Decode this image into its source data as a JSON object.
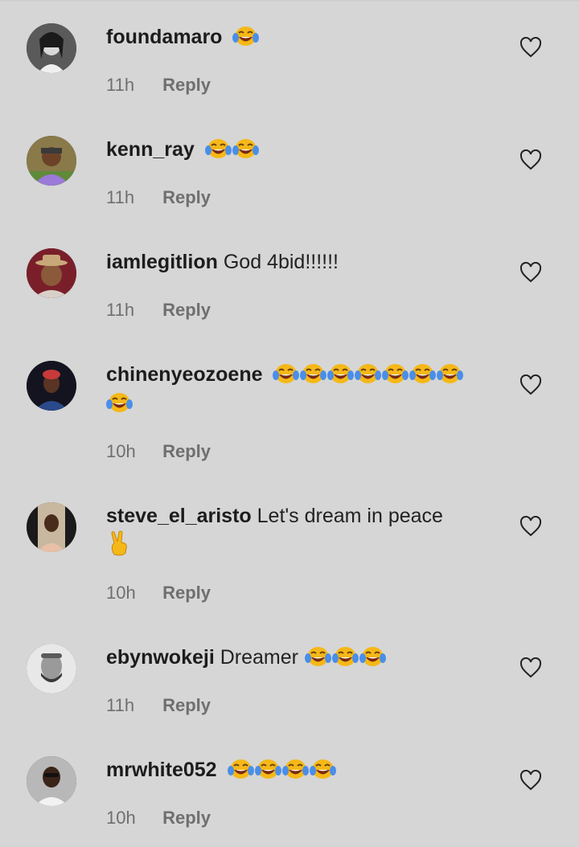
{
  "colors": {
    "background": "#d6d6d6",
    "username": "#1c1c1c",
    "meta": "#6f6f6f"
  },
  "comments": [
    {
      "username": "foundamaro",
      "text": "",
      "emojis": [
        "laughing-tears-emoji"
      ],
      "time": "11h",
      "reply_label": "Reply"
    },
    {
      "username": "kenn_ray",
      "text": "",
      "emojis": [
        "laughing-tears-emoji",
        "laughing-tears-emoji"
      ],
      "time": "11h",
      "reply_label": "Reply"
    },
    {
      "username": "iamlegitlion",
      "text": "God 4bid!!!!!!",
      "emojis": [],
      "time": "11h",
      "reply_label": "Reply"
    },
    {
      "username": "chinenyeozoene",
      "text": "",
      "emojis": [
        "laughing-tears-emoji",
        "laughing-tears-emoji",
        "laughing-tears-emoji",
        "laughing-tears-emoji",
        "laughing-tears-emoji",
        "laughing-tears-emoji",
        "laughing-tears-emoji",
        "laughing-tears-emoji"
      ],
      "time": "10h",
      "reply_label": "Reply"
    },
    {
      "username": "steve_el_aristo",
      "text": "Let's dream in peace",
      "emojis": [
        "peace-hand-emoji"
      ],
      "time": "10h",
      "reply_label": "Reply"
    },
    {
      "username": "ebynwokeji",
      "text": "Dreamer",
      "emojis": [
        "laughing-tears-emoji",
        "laughing-tears-emoji",
        "laughing-tears-emoji"
      ],
      "time": "11h",
      "reply_label": "Reply"
    },
    {
      "username": "mrwhite052",
      "text": "",
      "emojis": [
        "laughing-tears-emoji",
        "laughing-tears-emoji",
        "laughing-tears-emoji",
        "laughing-tears-emoji"
      ],
      "time": "10h",
      "reply_label": "Reply"
    }
  ]
}
